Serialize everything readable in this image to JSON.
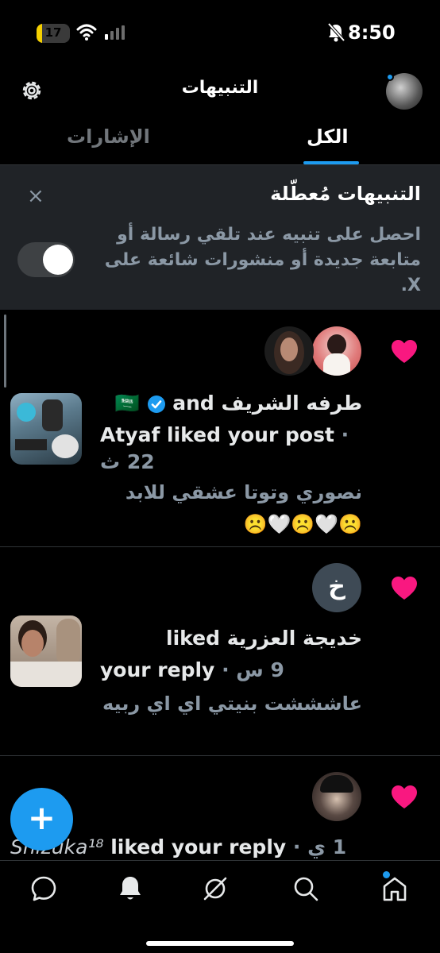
{
  "status_bar": {
    "time": "8:50",
    "battery_text": "17",
    "battery_percent": 17
  },
  "header": {
    "title": "التنبيهات"
  },
  "tabs": {
    "all": "الكل",
    "mentions": "الإشارات",
    "active": "all"
  },
  "banner": {
    "title": "التنبيهات مُعطّلة",
    "text": "احصل على تنبيه عند تلقي رسالة أو متابعة جديدة أو منشورات شائعة على X.",
    "close": "×",
    "toggle_on": false
  },
  "notifications": [
    {
      "line1": "طرفه الشريف 🇸🇦",
      "line1_suffix": "and",
      "line2": "Atyaf liked your post",
      "time": "22 ث",
      "post": "نصوري  وتوتا عشقي للابد",
      "emoji": "☹️🤍☹️🤍☹️",
      "avatar_letter": ""
    },
    {
      "line1": "خديجة العزرية",
      "line1_suffix": "liked",
      "line2": "your reply",
      "time": "9 س",
      "post": "عاشششت بنيتي اي اي ربيه",
      "avatar_letter": "خ"
    },
    {
      "line1": "Shizuka¹⁸",
      "line2": "liked your reply",
      "time": "1 ي"
    }
  ],
  "fab": {
    "label": "+"
  },
  "colors": {
    "accent": "#1d9bf0",
    "like": "#f91880",
    "background": "#000000",
    "banner": "#202327"
  }
}
